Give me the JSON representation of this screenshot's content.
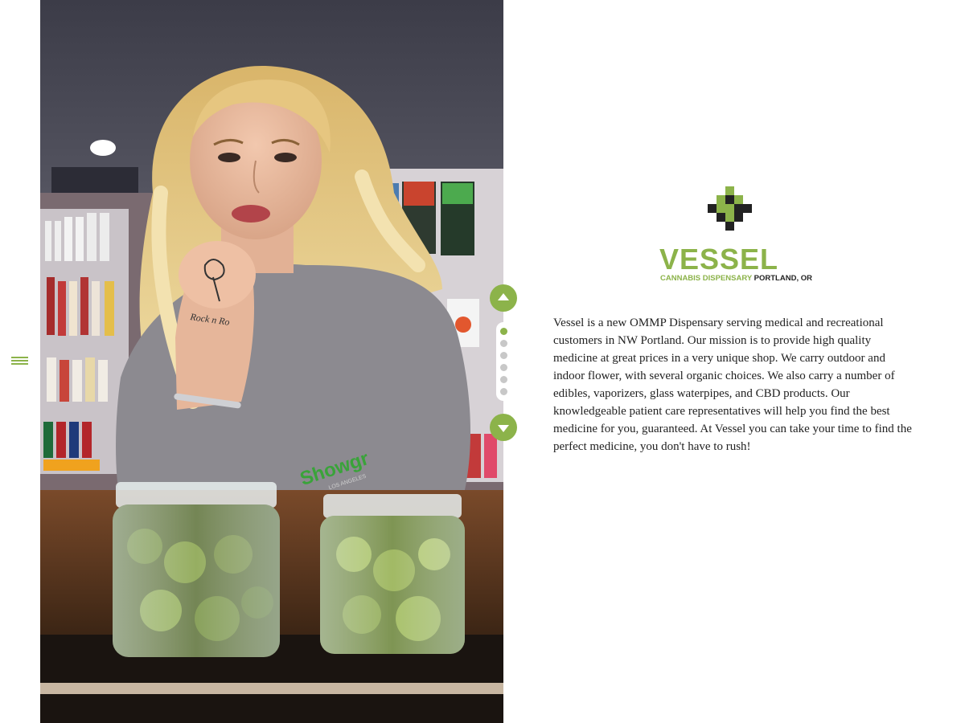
{
  "brand": {
    "name": "VESSEL",
    "tagline_green": "CANNABIS DISPENSARY",
    "tagline_dark": "PORTLAND, OR",
    "accent_color": "#8cb34a",
    "dark_color": "#222222"
  },
  "hero": {
    "alt": "Dispensary employee leaning on counter behind two jars of cannabis flower",
    "shirt_logo_text": "Showgr",
    "shirt_logo_sub": "LOS ANGELES"
  },
  "navigation": {
    "menu_icon": "hamburger-icon",
    "prev_icon": "arrow-up-icon",
    "next_icon": "arrow-down-icon",
    "slide_count": 6,
    "active_slide": 1
  },
  "about": {
    "description": "Vessel is a new OMMP Dispensary serving medical and recreational customers in NW Portland. Our mission is to provide high quality medicine at great prices in a very unique shop. We carry outdoor and indoor flower, with several organic choices. We also carry a number of edibles, vaporizers, glass waterpipes, and CBD products. Our knowledgeable patient care representatives will help you find the best medicine for you, guaranteed. At Vessel you can take your time to find the perfect medicine, you don't have to rush!"
  }
}
